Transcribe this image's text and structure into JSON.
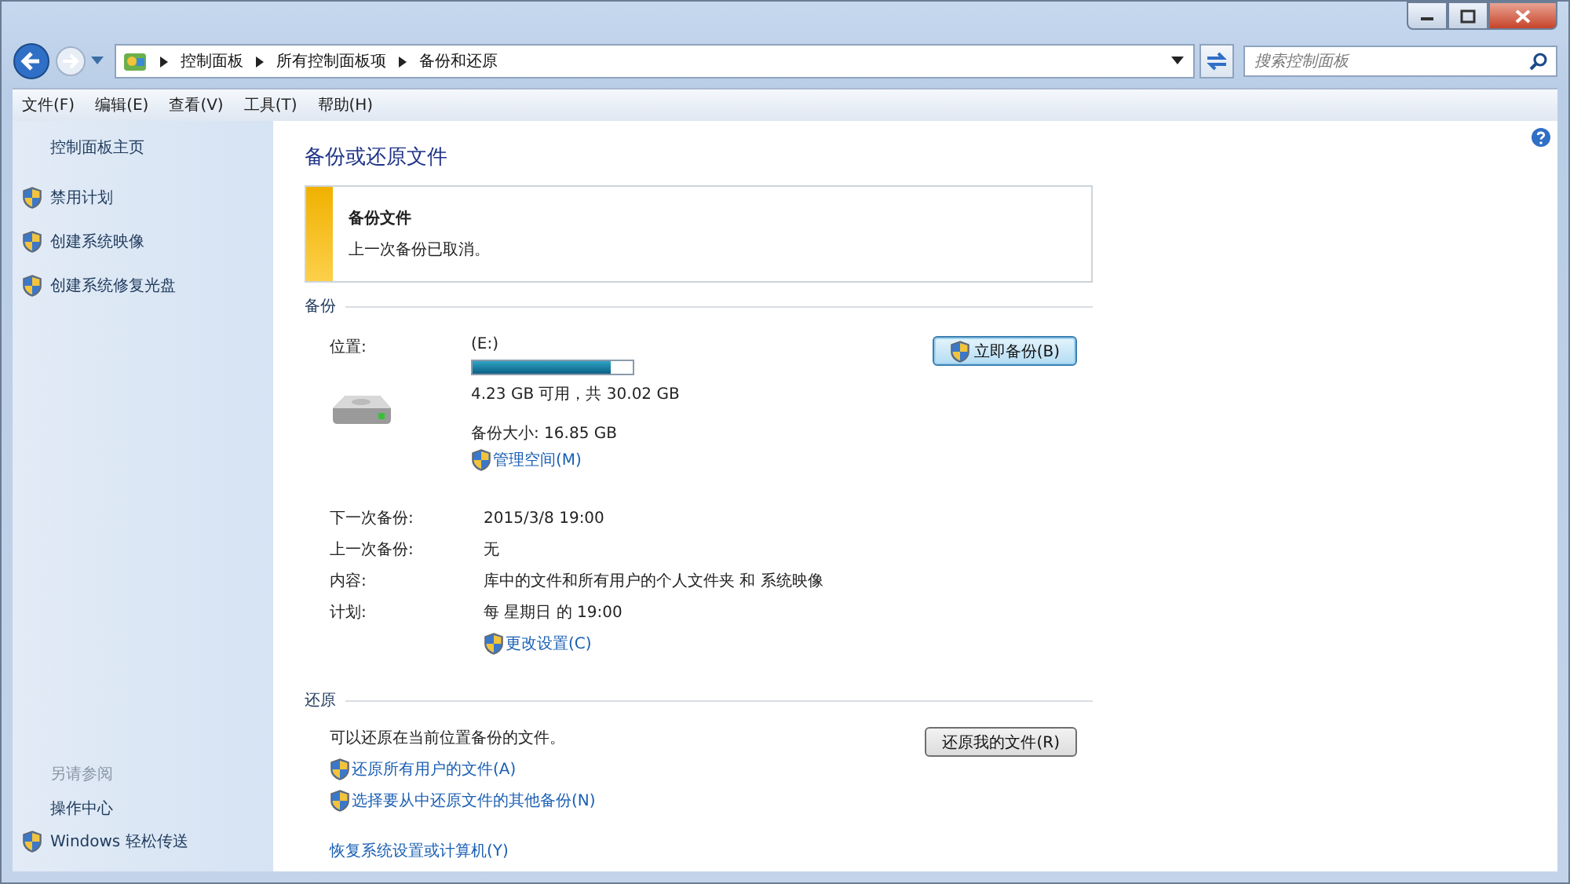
{
  "address_bar": {
    "breadcrumbs": [
      "控制面板",
      "所有控制面板项",
      "备份和还原"
    ],
    "search": {
      "placeholder": "搜索控制面板"
    }
  },
  "menu": [
    "文件(F)",
    "编辑(E)",
    "查看(V)",
    "工具(T)",
    "帮助(H)"
  ],
  "sidebar": {
    "home": "控制面板主页",
    "tasks": [
      {
        "label": "禁用计划",
        "shield": true
      },
      {
        "label": "创建系统映像",
        "shield": true
      },
      {
        "label": "创建系统修复光盘",
        "shield": true
      }
    ],
    "see_also_heading": "另请参阅",
    "see_also": [
      {
        "label": "操作中心",
        "shield": false
      },
      {
        "label": "Windows 轻松传送",
        "shield": true
      }
    ]
  },
  "main": {
    "title": "备份或还原文件",
    "alert": {
      "title": "备份文件",
      "message": "上一次备份已取消。"
    },
    "backup": {
      "heading": "备份",
      "location_label": "位置:",
      "drive": "(E:)",
      "level": 0.86,
      "space": "4.23 GB 可用，共 30.02 GB",
      "size": "备份大小: 16.85 GB",
      "manage_link": "管理空间(M)",
      "button": "立即备份(B)",
      "details": [
        {
          "label": "下一次备份:",
          "value": "2015/3/8 19:00"
        },
        {
          "label": "上一次备份:",
          "value": "无"
        },
        {
          "label": "内容:",
          "value": "库中的文件和所有用户的个人文件夹 和 系统映像"
        },
        {
          "label": "计划:",
          "value": "每 星期日 的 19:00"
        }
      ],
      "settings_link": "更改设置(C)"
    },
    "restore": {
      "heading": "还原",
      "text": "可以还原在当前位置备份的文件。",
      "button": "还原我的文件(R)",
      "links": [
        {
          "label": "还原所有用户的文件(A)",
          "shield": true
        },
        {
          "label": "选择要从中还原文件的其他备份(N)",
          "shield": true
        },
        {
          "label": "恢复系统设置或计算机(Y)",
          "shield": false
        }
      ]
    }
  }
}
